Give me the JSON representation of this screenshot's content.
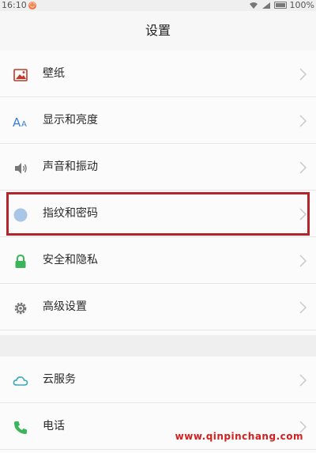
{
  "status_bar": {
    "time": "16:10",
    "battery": "100%"
  },
  "title": "设置",
  "group1": [
    {
      "label": "壁纸",
      "icon": "wallpaper-icon"
    },
    {
      "label": "显示和亮度",
      "icon": "font-size-icon"
    },
    {
      "label": "声音和振动",
      "icon": "speaker-icon"
    },
    {
      "label": "指纹和密码",
      "icon": "fingerprint-icon"
    },
    {
      "label": "安全和隐私",
      "icon": "lock-icon"
    },
    {
      "label": "高级设置",
      "icon": "gear-icon"
    }
  ],
  "group2": [
    {
      "label": "云服务",
      "icon": "cloud-icon"
    },
    {
      "label": "电话",
      "icon": "phone-icon"
    }
  ],
  "watermark": "www.qinpinchang.com",
  "colors": {
    "highlight": "#b3252b",
    "lock": "#3cb55a",
    "phone": "#3cb55a",
    "cloud": "#3aa8b6",
    "font_icon": "#3a7fd0",
    "watermark": "#d21f1f"
  }
}
